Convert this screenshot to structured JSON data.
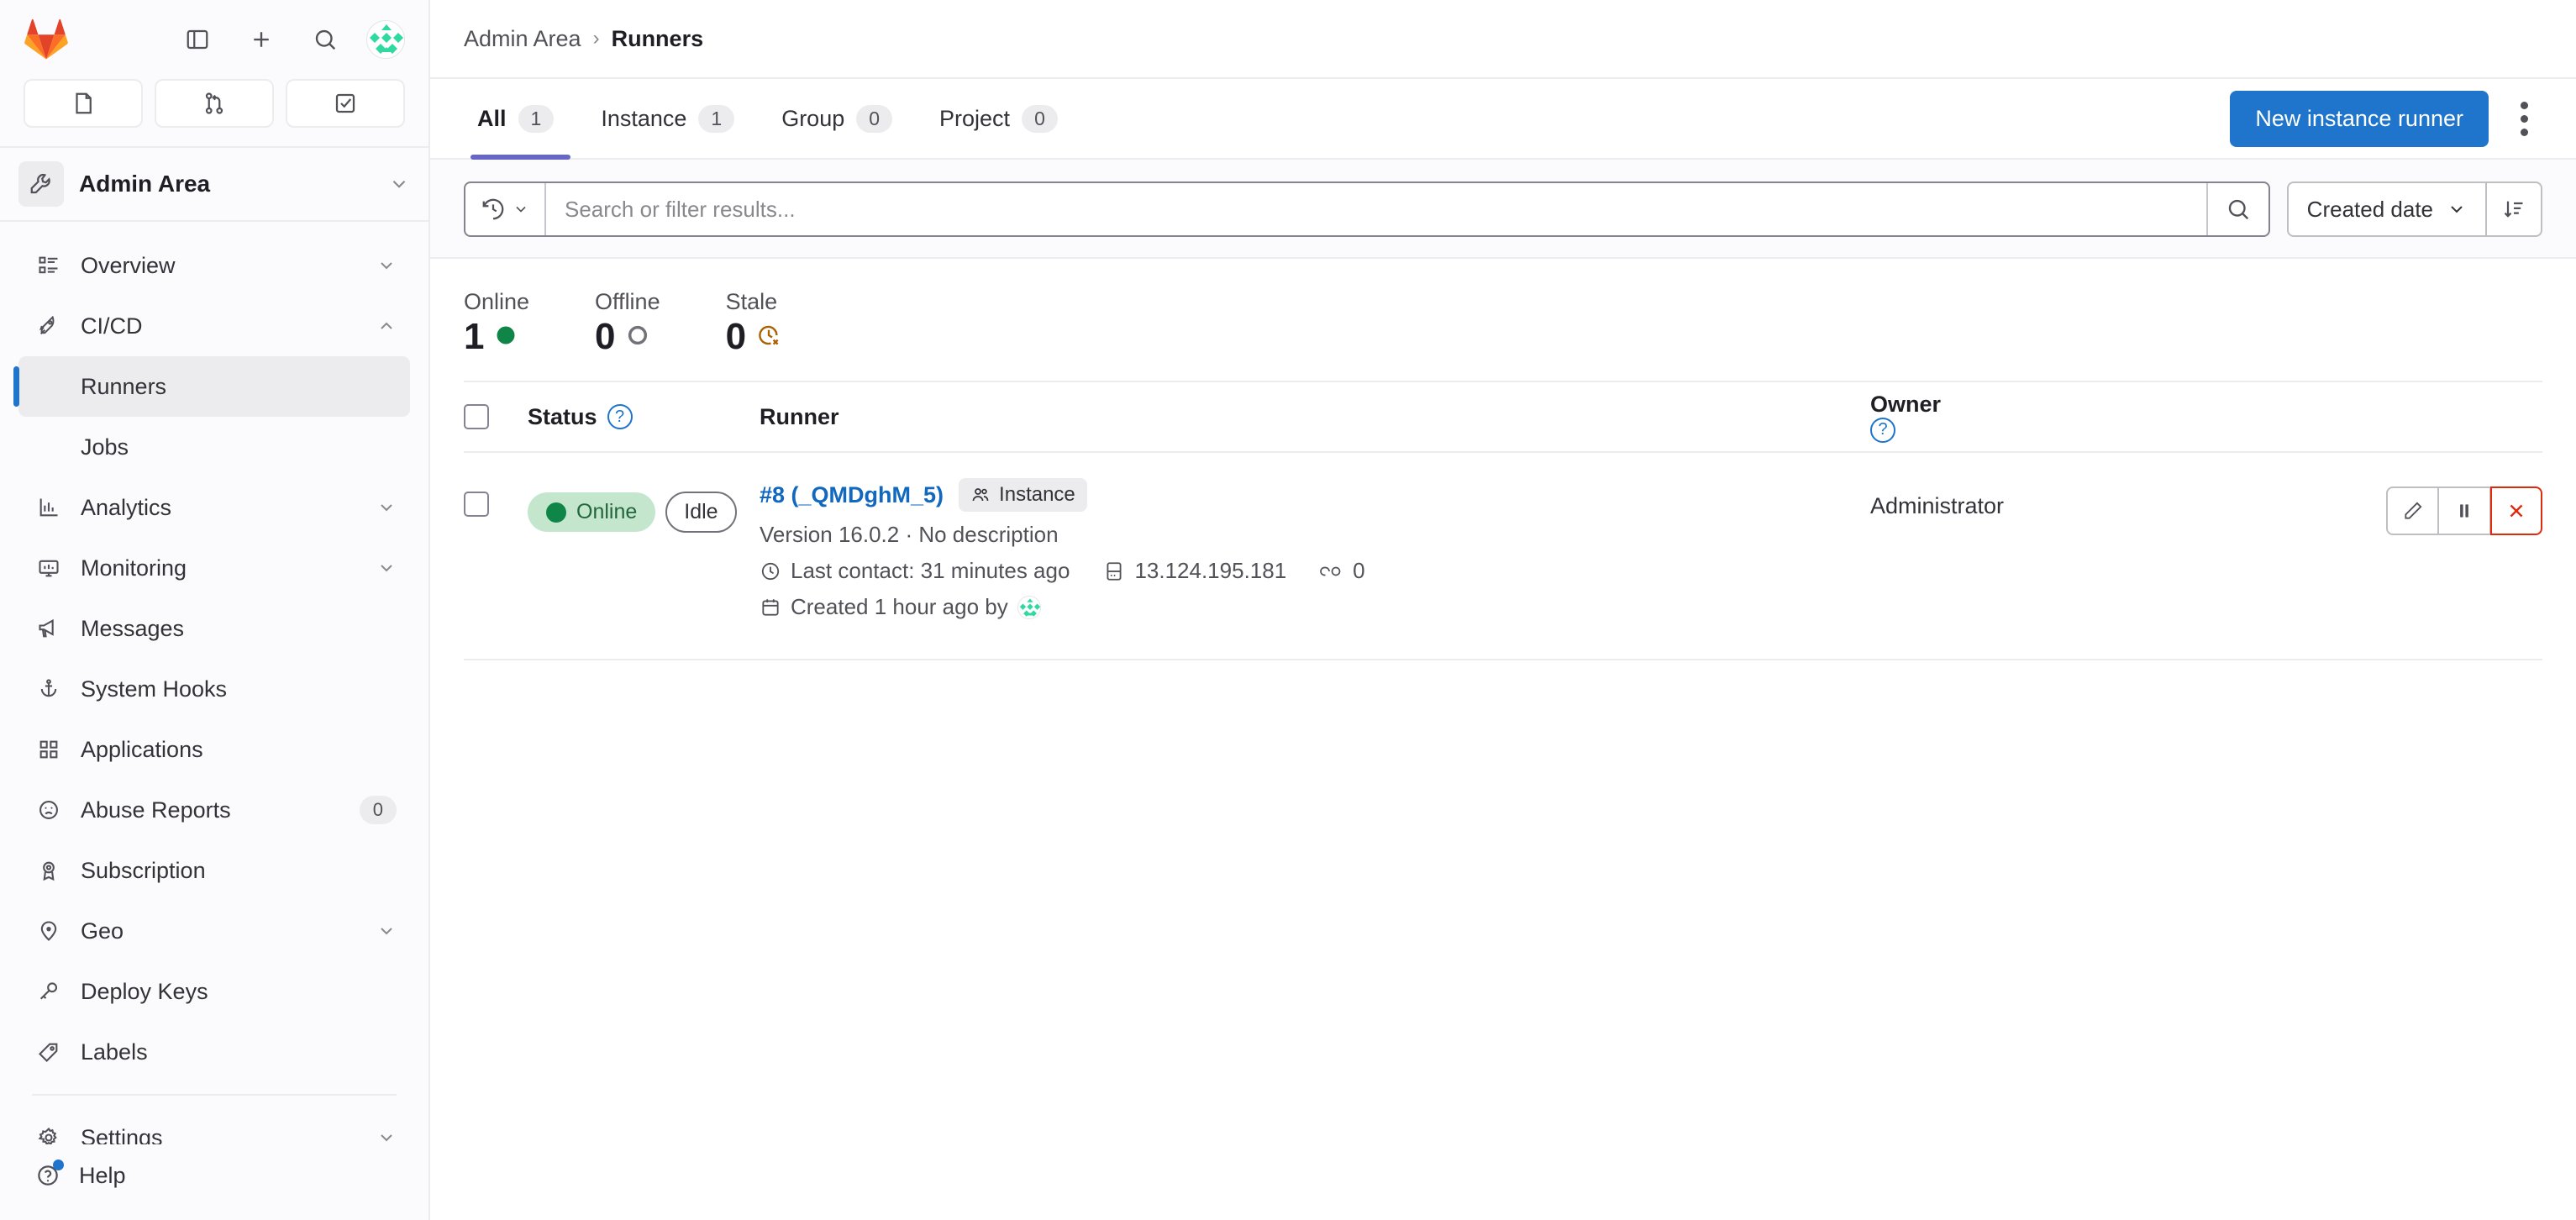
{
  "sidebar": {
    "top_icons": [
      {
        "name": "sidebar-toggle-icon",
        "label": "Toggle sidebar"
      },
      {
        "name": "new-item-icon",
        "label": "New..."
      },
      {
        "name": "search-icon",
        "label": "Search"
      },
      {
        "name": "user-avatar",
        "label": "User menu"
      }
    ],
    "quick_actions": [
      {
        "name": "issues-icon",
        "label": "Issues"
      },
      {
        "name": "merge-requests-icon",
        "label": "Merge requests"
      },
      {
        "name": "todos-icon",
        "label": "To-Do List"
      }
    ],
    "context": {
      "label": "Admin Area",
      "icon": "wrench-icon"
    },
    "items": [
      {
        "label": "Overview",
        "icon": "list-icon",
        "expandable": true,
        "indent": false,
        "active": false,
        "badge": null
      },
      {
        "label": "CI/CD",
        "icon": "rocket-icon",
        "expandable": true,
        "indent": false,
        "active": false,
        "badge": null
      },
      {
        "label": "Runners",
        "icon": null,
        "expandable": false,
        "indent": true,
        "active": true,
        "badge": null
      },
      {
        "label": "Jobs",
        "icon": null,
        "expandable": false,
        "indent": true,
        "active": false,
        "badge": null
      },
      {
        "label": "Analytics",
        "icon": "chart-icon",
        "expandable": true,
        "indent": false,
        "active": false,
        "badge": null
      },
      {
        "label": "Monitoring",
        "icon": "monitor-icon",
        "expandable": true,
        "indent": false,
        "active": false,
        "badge": null
      },
      {
        "label": "Messages",
        "icon": "megaphone-icon",
        "expandable": false,
        "indent": false,
        "active": false,
        "badge": null
      },
      {
        "label": "System Hooks",
        "icon": "hook-icon",
        "expandable": false,
        "indent": false,
        "active": false,
        "badge": null
      },
      {
        "label": "Applications",
        "icon": "applications-icon",
        "expandable": false,
        "indent": false,
        "active": false,
        "badge": null
      },
      {
        "label": "Abuse Reports",
        "icon": "sad-face-icon",
        "expandable": false,
        "indent": false,
        "active": false,
        "badge": "0"
      },
      {
        "label": "Subscription",
        "icon": "license-icon",
        "expandable": false,
        "indent": false,
        "active": false,
        "badge": null
      },
      {
        "label": "Geo",
        "icon": "location-icon",
        "expandable": true,
        "indent": false,
        "active": false,
        "badge": null
      },
      {
        "label": "Deploy Keys",
        "icon": "key-icon",
        "expandable": false,
        "indent": false,
        "active": false,
        "badge": null
      },
      {
        "label": "Labels",
        "icon": "tag-icon",
        "expandable": false,
        "indent": false,
        "active": false,
        "badge": null
      },
      {
        "label": "Settings",
        "icon": "gear-icon",
        "expandable": true,
        "indent": false,
        "active": false,
        "badge": null
      }
    ],
    "help": {
      "label": "Help",
      "icon": "question-circle-icon"
    }
  },
  "breadcrumb": {
    "root": "Admin Area",
    "separator": "›",
    "current": "Runners"
  },
  "tabs": [
    {
      "label": "All",
      "count": "1",
      "active": true
    },
    {
      "label": "Instance",
      "count": "1",
      "active": false
    },
    {
      "label": "Group",
      "count": "0",
      "active": false
    },
    {
      "label": "Project",
      "count": "0",
      "active": false
    }
  ],
  "toolbar": {
    "new_runner_label": "New instance runner",
    "kebab_label": "More actions"
  },
  "search": {
    "placeholder": "Search or filter results...",
    "value": "",
    "history_icon": "history-icon",
    "submit_icon": "search-icon"
  },
  "sort": {
    "selected": "Created date",
    "direction_icon": "sort-descending-icon"
  },
  "stats": [
    {
      "label": "Online",
      "value": "1",
      "indicator": "online-dot",
      "color": "#108548"
    },
    {
      "label": "Offline",
      "value": "0",
      "indicator": "offline-ring",
      "color": "#737278"
    },
    {
      "label": "Stale",
      "value": "0",
      "indicator": "stale-clock",
      "color": "#ab6100"
    }
  ],
  "table": {
    "headers": {
      "status": "Status",
      "runner": "Runner",
      "owner": "Owner"
    },
    "rows": [
      {
        "status": {
          "badge": "Online",
          "state": "Idle"
        },
        "runner": {
          "id_token": "#8 (_QMDghM_5)",
          "scope": "Instance",
          "scope_icon": "users-icon",
          "version_line": "Version 16.0.2 · No description",
          "last_contact": "Last contact: 31 minutes ago",
          "last_contact_icon": "clock-icon",
          "ip_address": "13.124.195.181",
          "ip_icon": "server-icon",
          "tags_count": "0",
          "tags_icon": "link-icon",
          "created": "Created 1 hour ago by",
          "created_icon": "calendar-icon"
        },
        "owner": "Administrator",
        "actions": [
          {
            "name": "edit-runner-button",
            "icon": "pencil-icon",
            "variant": "default"
          },
          {
            "name": "pause-runner-button",
            "icon": "pause-icon",
            "variant": "default"
          },
          {
            "name": "delete-runner-button",
            "icon": "close-icon",
            "variant": "danger"
          }
        ]
      }
    ]
  },
  "colors": {
    "brand_blue": "#1f75cb",
    "link_blue": "#1068bf",
    "active_tab": "#6666c4",
    "online_green": "#108548",
    "danger_red": "#dd2b0e",
    "stale_orange": "#ab6100"
  }
}
